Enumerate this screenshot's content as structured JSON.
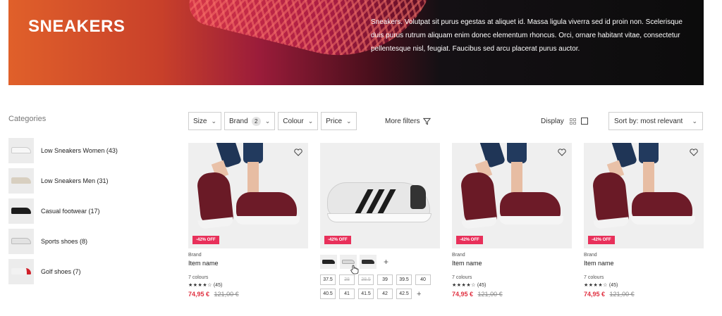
{
  "hero": {
    "title": "SNEAKERS",
    "description": "Sneakers. Volutpat sit purus egestas at aliquet id. Massa ligula viverra sed id proin non. Scelerisque duis purus rutrum aliquam enim donec elementum rhoncus. Orci, ornare habitant vitae, consectetur pellentesque nisl, feugiat. Faucibus sed arcu placerat purus auctor."
  },
  "sidebar": {
    "title": "Categories",
    "items": [
      {
        "label": "Low Sneakers Women (43)",
        "icon": "sneaker-white-thumbnail"
      },
      {
        "label": "Low Sneakers Men (31)",
        "icon": "sneaker-beige-thumbnail"
      },
      {
        "label": "Casual footwear (17)",
        "icon": "sneaker-black-thumbnail"
      },
      {
        "label": "Sports shoes (8)",
        "icon": "sneaker-grey-thumbnail"
      },
      {
        "label": "Golf shoes (7)",
        "icon": "sneaker-red-thumbnail"
      }
    ]
  },
  "filters": {
    "size": "Size",
    "brand": "Brand",
    "brand_count": "2",
    "colour": "Colour",
    "price": "Price",
    "more": "More filters",
    "display": "Display",
    "sort": "Sort by: most relevant"
  },
  "products": [
    {
      "brand": "Brand",
      "name": "Item name",
      "colours": "7 colours",
      "stars": "★★★★☆",
      "reviews": "(45)",
      "price": "74,95 €",
      "old_price": "121,00 €",
      "sale": "-42% OFF"
    },
    {
      "sale": "-42% OFF"
    },
    {
      "brand": "Brand",
      "name": "Item name",
      "colours": "7 colours",
      "stars": "★★★★☆",
      "reviews": "(45)",
      "price": "74,95 €",
      "old_price": "121,00 €",
      "sale": "-42% OFF"
    },
    {
      "brand": "Brand",
      "name": "Item name",
      "colours": "7 colours",
      "stars": "★★★★☆",
      "reviews": "(45)",
      "price": "74,95 €",
      "old_price": "121,00 €",
      "sale": "-42% OFF"
    }
  ],
  "sizes": {
    "row1": [
      "37.5",
      "38",
      "38.5",
      "39",
      "39.5",
      "40"
    ],
    "row2": [
      "40.5",
      "41",
      "41.5",
      "42",
      "42.5"
    ],
    "unavailable": [
      "38",
      "38.5"
    ]
  },
  "colors": {
    "sale": "#e8305a",
    "price": "#e03040",
    "hero_start": "#e0602a",
    "hero_end": "#0c0c0c"
  }
}
